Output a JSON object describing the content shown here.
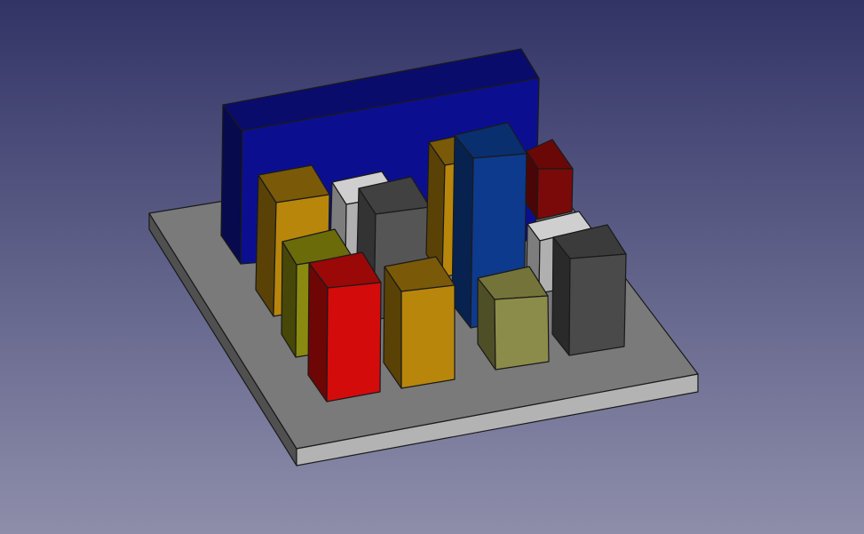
{
  "viewport": {
    "background_top": "#323466",
    "background_bottom": "#8e8eab"
  },
  "scene": {
    "base_plate": {
      "top": "#7a7a7a",
      "front": "#b3b3b3",
      "left": "#505050"
    },
    "back_panel": {
      "front": "#0b0f8f",
      "top": "#0a0c6c",
      "left": "#070a4d"
    },
    "blocks": [
      {
        "name": "gold-block-back-left",
        "front": "#b8860b",
        "top": "#7a5a08",
        "left": "#5a4206"
      },
      {
        "name": "light-gray-block-back",
        "front": "#b0b0b0",
        "top": "#cfcfcf",
        "left": "#7d7d7d"
      },
      {
        "name": "dark-gray-block-back",
        "front": "#555555",
        "top": "#414141",
        "left": "#333333"
      },
      {
        "name": "gold-block-back-right",
        "front": "#b8860b",
        "top": "#7a5a08",
        "left": "#5a4206"
      },
      {
        "name": "blue-tall-block",
        "front": "#0d3a8c",
        "top": "#0a2f6e",
        "left": "#08224f"
      },
      {
        "name": "dark-red-block",
        "front": "#7a0a0a",
        "top": "#6a0808",
        "left": "#4a0606"
      },
      {
        "name": "light-gray-block-right",
        "front": "#b0b0b0",
        "top": "#cfcfcf",
        "left": "#7d7d7d"
      },
      {
        "name": "dark-gray-block-right",
        "front": "#4a4a4a",
        "top": "#3b3b3b",
        "left": "#2a2a2a"
      },
      {
        "name": "olive-block",
        "front": "#8a8a10",
        "top": "#6b6b0a",
        "left": "#474708"
      },
      {
        "name": "red-block",
        "front": "#d40b0b",
        "top": "#9a0808",
        "left": "#6e0606"
      },
      {
        "name": "gold-block-front",
        "front": "#b8860b",
        "top": "#7a5a08",
        "left": "#5a4206"
      },
      {
        "name": "khaki-block",
        "front": "#8c8c4a",
        "top": "#74743a",
        "left": "#4f4f27"
      }
    ]
  }
}
